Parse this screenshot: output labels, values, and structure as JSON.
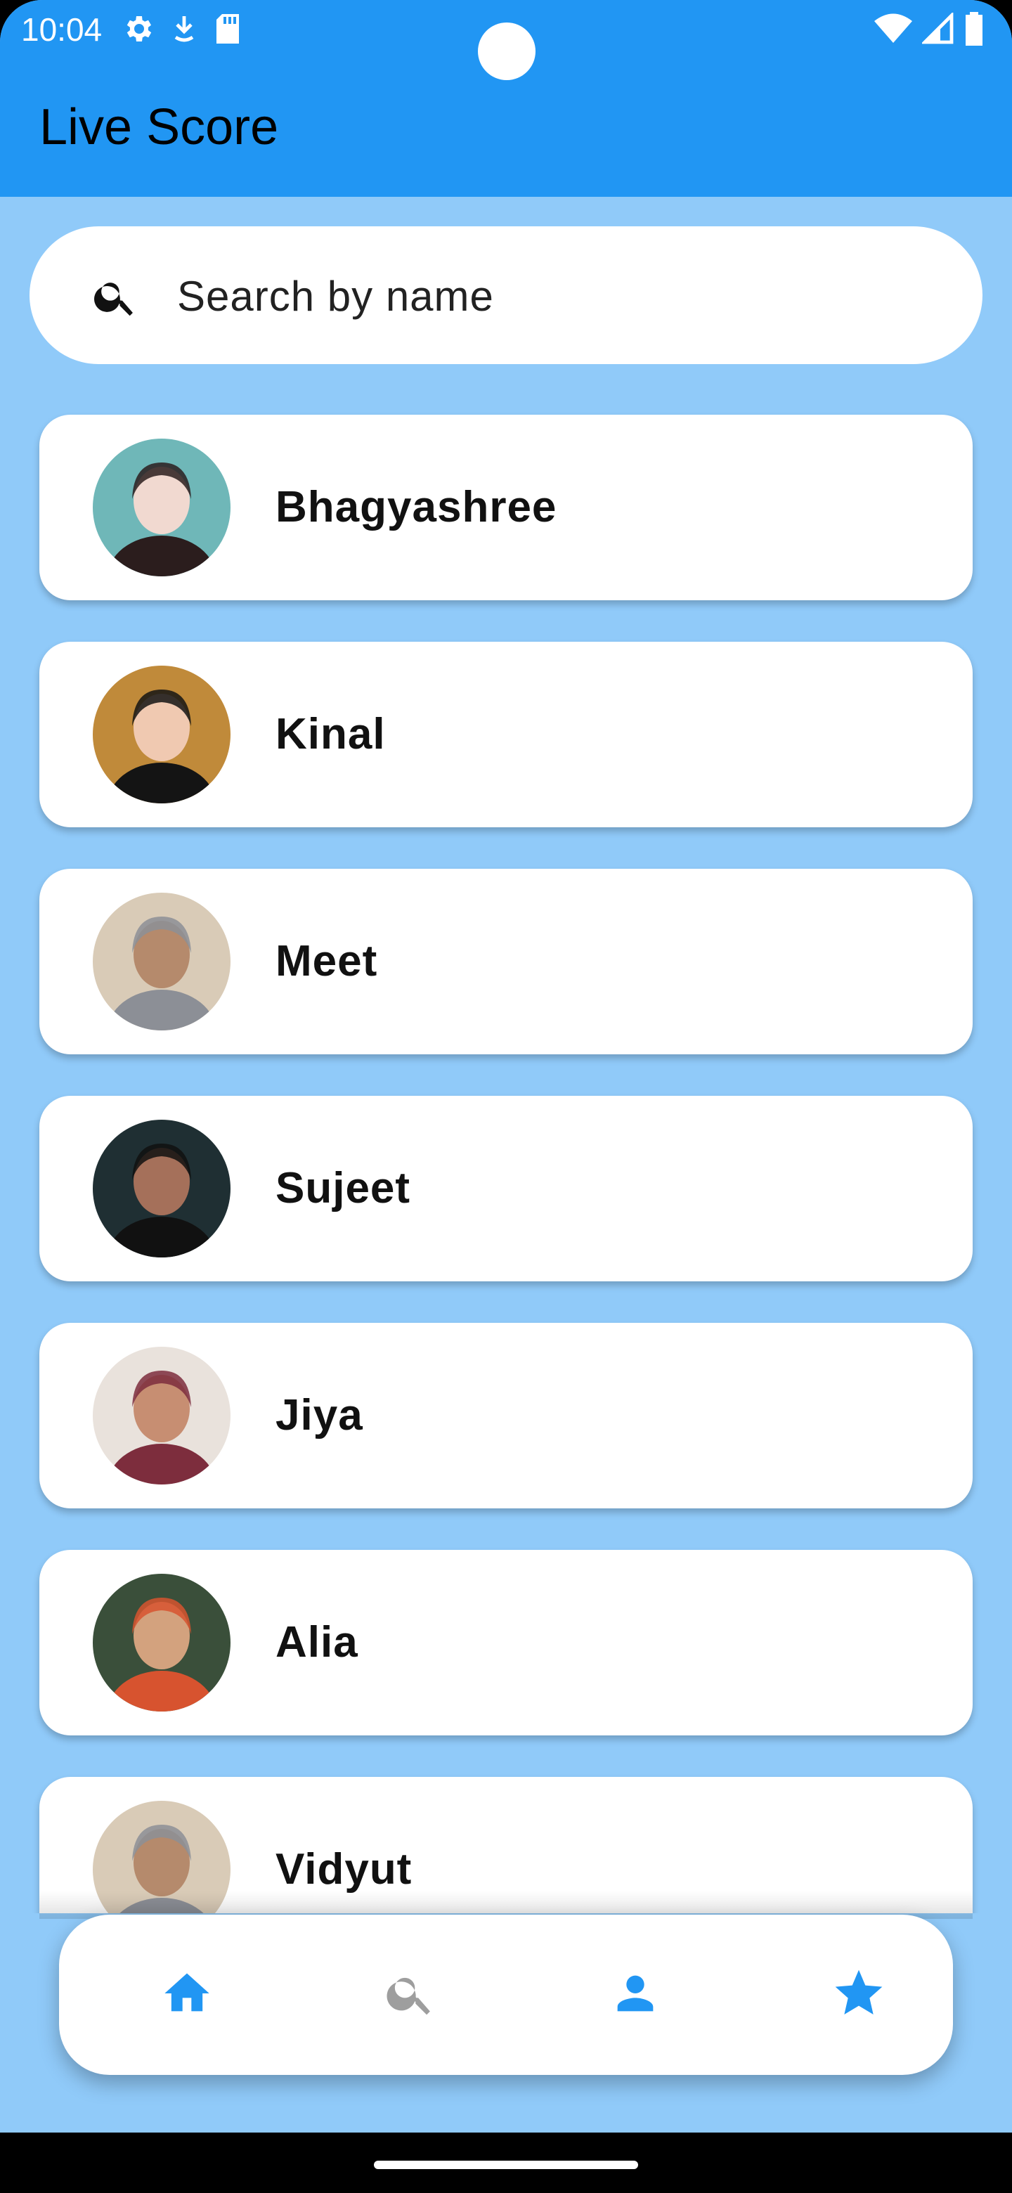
{
  "status_bar": {
    "time": "10:04"
  },
  "app_bar": {
    "title": "Live Score"
  },
  "search": {
    "placeholder": "Search by name"
  },
  "players": [
    {
      "name": "Bhagyashree",
      "avatar_colors": [
        "#6fb7b8",
        "#f1d9d0",
        "#2b1d1d"
      ]
    },
    {
      "name": "Kinal",
      "avatar_colors": [
        "#c08a3a",
        "#f0c9b1",
        "#141414"
      ]
    },
    {
      "name": "Meet",
      "avatar_colors": [
        "#d9cbb7",
        "#b58a6c",
        "#8c8f96"
      ]
    },
    {
      "name": "Sujeet",
      "avatar_colors": [
        "#1f2f33",
        "#a5705a",
        "#111111"
      ]
    },
    {
      "name": "Jiya",
      "avatar_colors": [
        "#e9e2dc",
        "#c78e72",
        "#7d2d3d"
      ]
    },
    {
      "name": "Alia",
      "avatar_colors": [
        "#3a4f3a",
        "#d3a27e",
        "#d7532f"
      ]
    },
    {
      "name": "Vidyut",
      "avatar_colors": [
        "#d9cbb7",
        "#b58a6c",
        "#8c8f96"
      ]
    }
  ],
  "bottom_nav": {
    "items": [
      {
        "icon": "home-icon",
        "color": "#2196F3"
      },
      {
        "icon": "search-icon",
        "color": "#9E9E9E"
      },
      {
        "icon": "person-icon",
        "color": "#2196F3"
      },
      {
        "icon": "star-icon",
        "color": "#2196F3"
      }
    ]
  },
  "colors": {
    "app_bar": "#2196F3",
    "background": "#90CAF9",
    "card": "#FFFFFF"
  }
}
